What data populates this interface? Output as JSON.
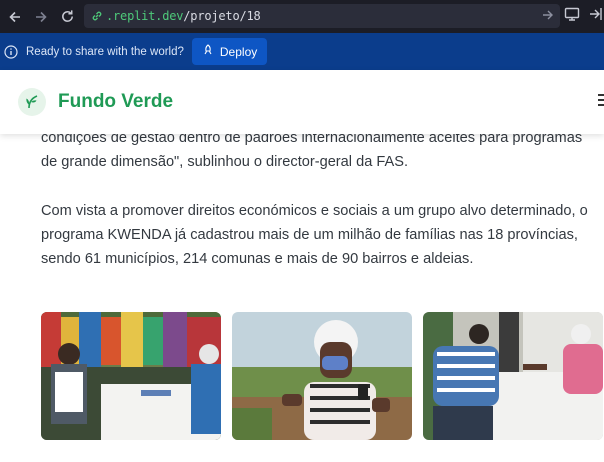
{
  "browser": {
    "url_domain": ".replit.dev",
    "url_path": "/projeto/18"
  },
  "share_banner": {
    "text": "Ready to share with the world?",
    "deploy_label": "Deploy"
  },
  "site": {
    "brand": "Fundo Verde",
    "brand_color": "#1f9a55"
  },
  "article": {
    "paragraph1": "condições de gestão dentro de padrões internacionalmente aceites para programas de grande dimensão\", sublinhou o director-geral da FAS.",
    "paragraph2": "Com vista a promover direitos económicos e sociais a um grupo alvo determinado, o programa KWENDA já cadastrou mais de um milhão de famílias nas 18 províncias, sendo 61 municípios, 214 comunas e mais de 90 bairros e aldeias."
  },
  "photos": [
    {
      "subject": "registration-desk-crowd"
    },
    {
      "subject": "woman-with-phone"
    },
    {
      "subject": "men-at-table"
    }
  ]
}
